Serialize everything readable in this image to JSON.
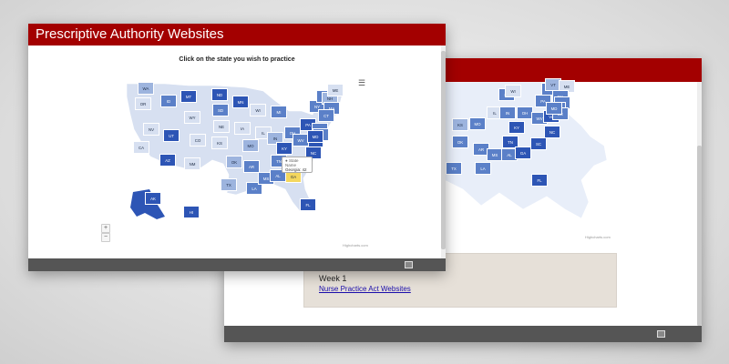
{
  "app": {
    "title": "Prescriptive Authority Websites",
    "colors": {
      "header": "#a30000",
      "footer": "#555555",
      "highlight": "#f4d75e",
      "dark": "#2d55b5",
      "mid": "#5b80c8",
      "light": "#9db4de",
      "pale": "#d7e0f1"
    }
  },
  "map": {
    "title": "Click on the state you wish to practice",
    "menu_icon": "hamburger-menu-icon",
    "zoom_in": "+",
    "zoom_out": "−",
    "credit": "Highcharts.com",
    "tooltip": {
      "series": "● State Name",
      "state": "Georgia",
      "value": "42"
    }
  },
  "back_window": {
    "card_title": "Week 1",
    "card_link": "Nurse Practice Act Websites",
    "credit": "Highcharts.com"
  },
  "states": [
    [
      "WA",
      160,
      97,
      "light"
    ],
    [
      "OR",
      157,
      114,
      "pale"
    ],
    [
      "CA",
      155,
      162,
      "pale"
    ],
    [
      "NV",
      166,
      142,
      "pale"
    ],
    [
      "ID",
      185,
      111,
      "mid"
    ],
    [
      "MT",
      207,
      106,
      "dark"
    ],
    [
      "WY",
      211,
      129,
      "pale"
    ],
    [
      "UT",
      188,
      149,
      "dark"
    ],
    [
      "AZ",
      184,
      176,
      "dark"
    ],
    [
      "CO",
      217,
      154,
      "pale"
    ],
    [
      "NM",
      211,
      180,
      "pale"
    ],
    [
      "ND",
      241,
      104,
      "dark"
    ],
    [
      "SD",
      242,
      121,
      "mid"
    ],
    [
      "NE",
      243,
      139,
      "pale"
    ],
    [
      "KS",
      241,
      157,
      "pale"
    ],
    [
      "OK",
      257,
      178,
      "light"
    ],
    [
      "TX",
      251,
      203,
      "light"
    ],
    [
      "MN",
      264,
      112,
      "dark"
    ],
    [
      "IA",
      266,
      141,
      "pale"
    ],
    [
      "MO",
      275,
      160,
      "light"
    ],
    [
      "AR",
      276,
      183,
      "mid"
    ],
    [
      "LA",
      279,
      207,
      "mid"
    ],
    [
      "WI",
      283,
      121,
      "pale"
    ],
    [
      "IL",
      289,
      146,
      "pale"
    ],
    [
      "MI",
      306,
      123,
      "mid"
    ],
    [
      "IN",
      302,
      152,
      "light"
    ],
    [
      "OH",
      321,
      146,
      "mid"
    ],
    [
      "KY",
      312,
      163,
      "dark"
    ],
    [
      "TN",
      306,
      177,
      "mid"
    ],
    [
      "MS",
      292,
      196,
      "mid"
    ],
    [
      "AL",
      305,
      193,
      "mid"
    ],
    [
      "GA",
      322,
      194,
      "highlight"
    ],
    [
      "FL",
      338,
      225,
      "dark"
    ],
    [
      "SC",
      334,
      181,
      "dark"
    ],
    [
      "NC",
      344,
      168,
      "dark"
    ],
    [
      "VA",
      346,
      155,
      "dark"
    ],
    [
      "WV",
      330,
      154,
      "mid"
    ],
    [
      "PA",
      338,
      137,
      "dark"
    ],
    [
      "NY",
      348,
      117,
      "mid"
    ],
    [
      "VT",
      356,
      106,
      "mid"
    ],
    [
      "NH",
      362,
      108,
      "light"
    ],
    [
      "ME",
      368,
      99,
      "pale"
    ],
    [
      "MA",
      364,
      119,
      "mid"
    ],
    [
      "CT",
      358,
      127,
      "mid"
    ],
    [
      "NJ",
      351,
      142,
      "mid"
    ],
    [
      "DE",
      352,
      148,
      "mid"
    ],
    [
      "MD",
      346,
      150,
      "dark"
    ],
    [
      "AK",
      168,
      218,
      "dark"
    ],
    [
      "HI",
      210,
      233,
      "dark"
    ]
  ],
  "back_states": [
    [
      "MO",
      524,
      136,
      "mid"
    ],
    [
      "IL",
      543,
      124,
      "pale"
    ],
    [
      "IN",
      557,
      124,
      "mid"
    ],
    [
      "OH",
      576,
      124,
      "mid"
    ],
    [
      "KY",
      567,
      140,
      "dark"
    ],
    [
      "TN",
      560,
      156,
      "dark"
    ],
    [
      "OK",
      505,
      156,
      "mid"
    ],
    [
      "AR",
      528,
      164,
      "mid"
    ],
    [
      "TX",
      498,
      185,
      "mid"
    ],
    [
      "LA",
      530,
      185,
      "mid"
    ],
    [
      "MS",
      543,
      170,
      "mid"
    ],
    [
      "AL",
      559,
      170,
      "mid"
    ],
    [
      "GA",
      574,
      168,
      "dark"
    ],
    [
      "SC",
      591,
      158,
      "dark"
    ],
    [
      "FL",
      592,
      198,
      "dark"
    ],
    [
      "WV",
      592,
      130,
      "mid"
    ],
    [
      "VA",
      605,
      128,
      "dark"
    ],
    [
      "NC",
      606,
      145,
      "dark"
    ],
    [
      "PA",
      596,
      111,
      "mid"
    ],
    [
      "NY",
      603,
      98,
      "mid"
    ],
    [
      "VT",
      607,
      93,
      "light"
    ],
    [
      "ME",
      622,
      95,
      "pale"
    ],
    [
      "MA",
      615,
      106,
      "mid"
    ],
    [
      "MI",
      556,
      104,
      "mid"
    ],
    [
      "CT",
      617,
      113,
      "mid"
    ],
    [
      "NJ",
      612,
      119,
      "mid"
    ],
    [
      "DE",
      615,
      125,
      "mid"
    ],
    [
      "MD",
      608,
      119,
      "mid"
    ],
    [
      "KS",
      505,
      137,
      "light"
    ],
    [
      "WI",
      563,
      100,
      "pale"
    ]
  ]
}
